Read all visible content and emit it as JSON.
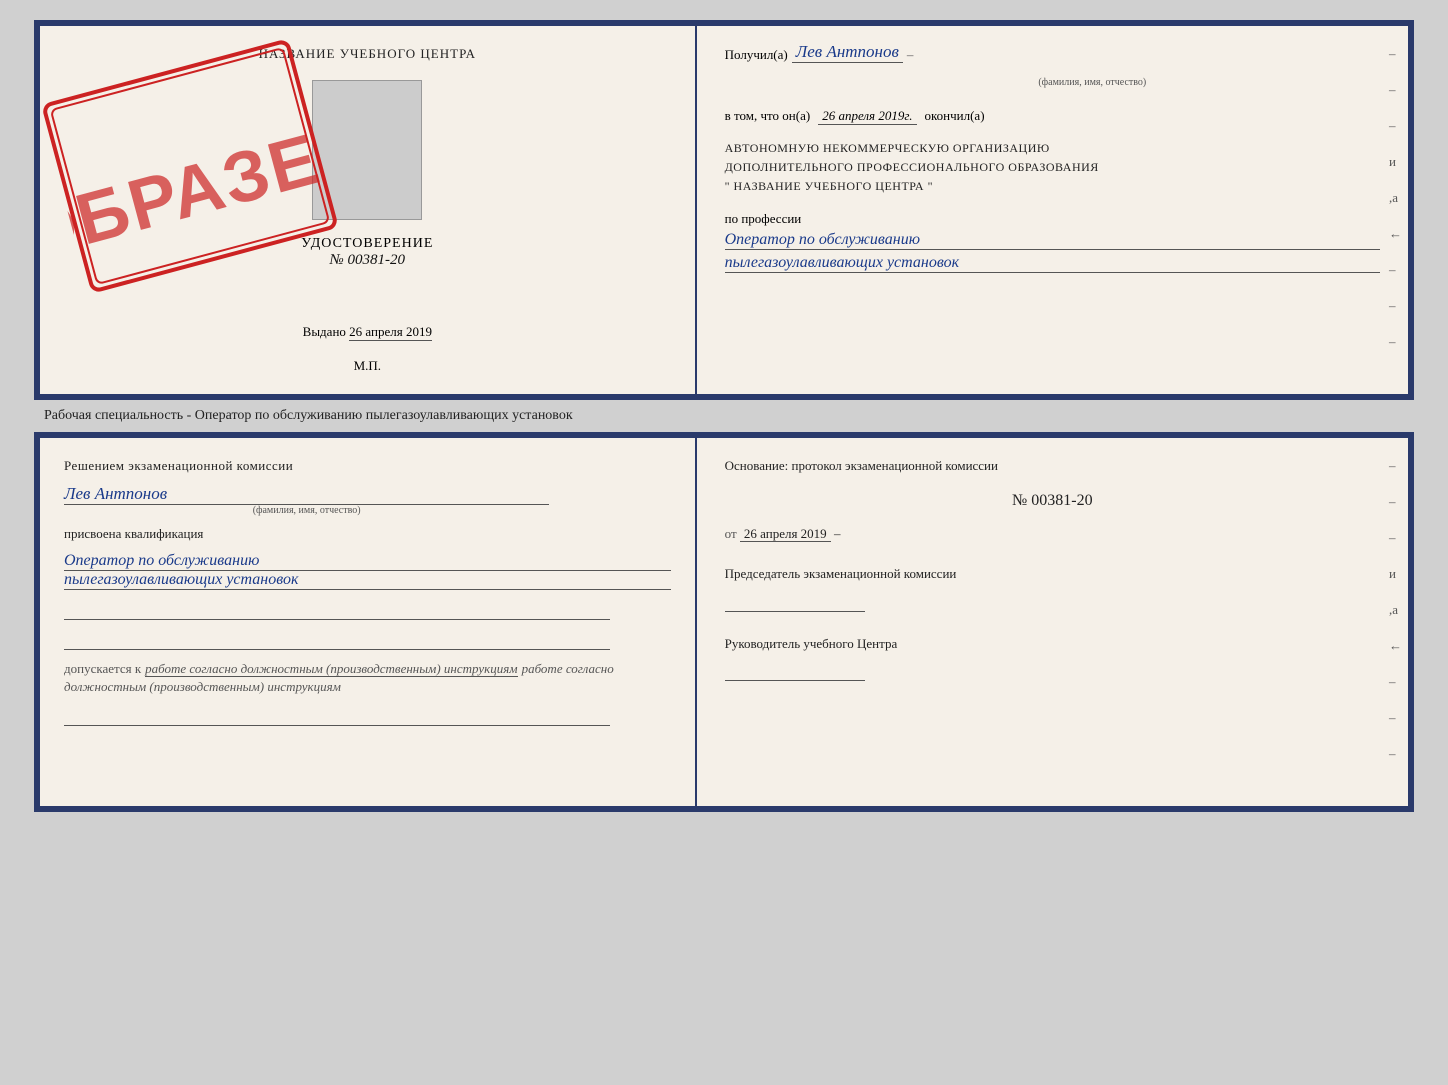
{
  "top_left": {
    "edu_center": "НАЗВАНИЕ УЧЕБНОГО ЦЕНТРА",
    "udostoverenie": "УДОСТОВЕРЕНИЕ",
    "number": "№ 00381-20",
    "vydano_label": "Выдано",
    "vydano_date": "26 апреля 2019",
    "mp": "М.П."
  },
  "stamp": {
    "text": "ОБРАЗЕЦ"
  },
  "top_right": {
    "received_label": "Получил(а)",
    "received_name": "Лев Антпонов",
    "fio_sublabel": "(фамилия, имя, отчество)",
    "v_tom_label": "в том, что он(а)",
    "v_tom_date": "26 апреля 2019г.",
    "okonchil_label": "окончил(а)",
    "org_line1": "АВТОНОМНУЮ НЕКОММЕРЧЕСКУЮ ОРГАНИЗАЦИЮ",
    "org_line2": "ДОПОЛНИТЕЛЬНОГО ПРОФЕССИОНАЛЬНОГО ОБРАЗОВАНИЯ",
    "org_quote_open": "\"",
    "org_name": "НАЗВАНИЕ УЧЕБНОГО ЦЕНТРА",
    "org_quote_close": "\"",
    "profession_label": "по профессии",
    "profession_line1": "Оператор по обслуживанию",
    "profession_line2": "пылегазоулавливающих установок",
    "dashes": [
      "-",
      "-",
      "-",
      "и",
      ",а",
      "←",
      "-",
      "-",
      "-"
    ]
  },
  "middle_label": "Рабочая специальность - Оператор по обслуживанию пылегазоулавливающих установок",
  "bottom_left": {
    "komissia_text": "Решением экзаменационной комиссии",
    "person_name": "Лев Антпонов",
    "fio_sublabel": "(фамилия, имя, отчество)",
    "assigned_label": "присвоена квалификация",
    "qual_line1": "Оператор по обслуживанию",
    "qual_line2": "пылегазоулавливающих установок",
    "dopuskaetsya_prefix": "допускается к",
    "dopuskaetsya_italic": "работе согласно должностным (производственным) инструкциям"
  },
  "bottom_right": {
    "osnova_label": "Основание: протокол экзаменационной комиссии",
    "protocol_number": "№  00381-20",
    "protocol_date_prefix": "от",
    "protocol_date": "26 апреля 2019",
    "predsedatel_label": "Председатель экзаменационной комиссии",
    "rukovoditel_label": "Руководитель учебного Центра",
    "dashes": [
      "-",
      "-",
      "-",
      "и",
      ",а",
      "←",
      "-",
      "-",
      "-"
    ]
  }
}
